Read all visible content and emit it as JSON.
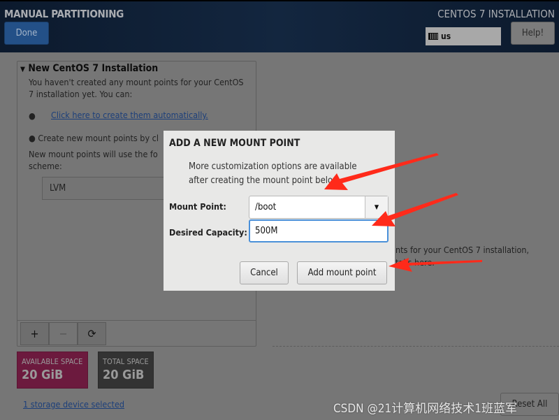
{
  "header": {
    "title": "MANUAL PARTITIONING",
    "subtitle": "CENTOS 7 INSTALLATION",
    "done_label": "Done",
    "keyboard_layout": "us",
    "help_label": "Help!"
  },
  "left_panel": {
    "title": "New CentOS 7 Installation",
    "intro_1": "You haven't created any mount points for your CentOS",
    "intro_2": "7 installation yet.  You can:",
    "auto_link": "Click here to create them automatically.",
    "manual_text": "Create new mount points by cl",
    "scheme_text_1": "New mount points will use the fo",
    "scheme_text_2": "scheme:",
    "scheme_value": "LVM",
    "add_icon": "+",
    "remove_icon": "−",
    "refresh_icon": "⟳"
  },
  "space": {
    "available_label": "AVAILABLE SPACE",
    "available_value": "20 GiB",
    "total_label": "TOTAL SPACE",
    "total_value": "20 GiB"
  },
  "storage_link": "1 storage device selected",
  "right_text": {
    "line1": "nts for your CentOS 7 installation,",
    "line2": "tails here."
  },
  "reset_label": "Reset All",
  "dialog": {
    "title": "ADD A NEW MOUNT POINT",
    "text_1": "More customization options are available",
    "text_2": "after creating the mount point below.",
    "mount_point_label": "Mount Point:",
    "mount_point_value": "/boot",
    "capacity_label": "Desired Capacity:",
    "capacity_value": "500M",
    "cancel_label": "Cancel",
    "add_label": "Add mount point"
  },
  "annotation_color": "#ff2a1a",
  "watermark": "CSDN @21计算机网络技术1班蓝军"
}
